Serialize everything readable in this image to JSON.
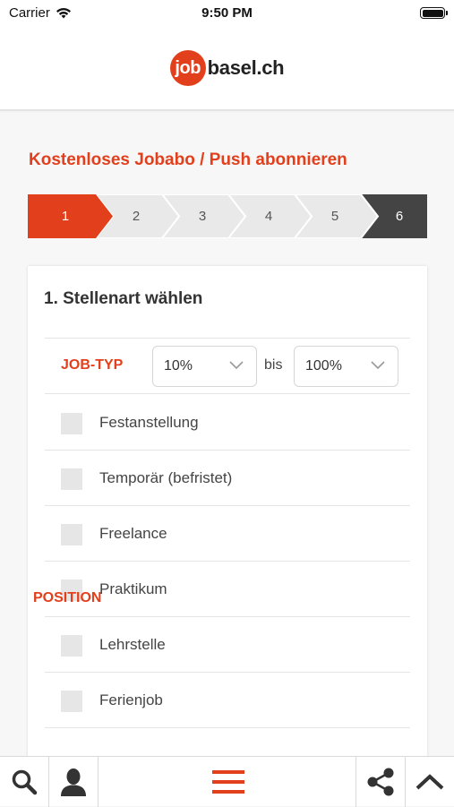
{
  "status_bar": {
    "carrier": "Carrier",
    "time": "9:50 PM"
  },
  "brand": {
    "logo_circle": "job",
    "logo_text": "basel.ch",
    "accent": "#e2401d",
    "dark": "#444444"
  },
  "page": {
    "title": "Kostenloses Jobabo / Push abonnieren",
    "steps": [
      "1",
      "2",
      "3",
      "4",
      "5",
      "6"
    ],
    "active_step": "1"
  },
  "form": {
    "section_title": "1. Stellenart wählen",
    "job_type": {
      "label": "JOB-TYP",
      "from_value": "10%",
      "separator": "bis",
      "to_value": "100%"
    },
    "options": [
      "Festanstellung",
      "Temporär (befristet)",
      "Freelance",
      "Praktikum",
      "Lehrstelle",
      "Ferienjob"
    ],
    "next_section_label": "POSITION"
  },
  "toolbar": {
    "icons": [
      "search-icon",
      "user-icon",
      "menu-icon",
      "share-icon",
      "chevron-up-icon"
    ]
  }
}
